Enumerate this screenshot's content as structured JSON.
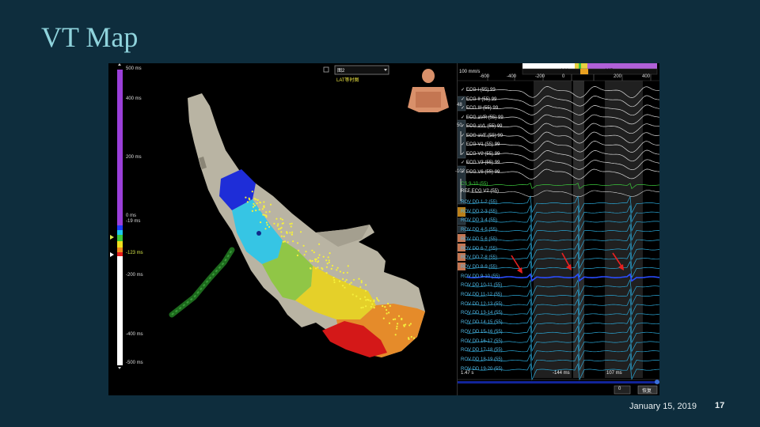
{
  "slide": {
    "title": "VT Map",
    "date": "January 15, 2019",
    "page_number": "17"
  },
  "map": {
    "view_select_value": "图2",
    "lat_label": "LAT等时图",
    "scale_ticks": [
      "500 ms",
      "400 ms",
      "200 ms",
      "0 ms",
      "-19 ms",
      "-123 ms",
      "-200 ms",
      "-400 ms",
      "-500 ms"
    ],
    "palette": {
      "purple": "#9b3fd9",
      "blue": "#1e3cff",
      "cyan": "#1ec8f0",
      "green": "#3cc83c",
      "yellow": "#f0e01e",
      "orange": "#f08c1e",
      "red": "#e61e1e",
      "white": "#ffffff"
    }
  },
  "ep": {
    "sweep_speed": "100 mm/s",
    "timeline_labels": [
      "-600",
      "-400",
      "-200",
      "0",
      "200",
      "400"
    ],
    "timeline_markers": [
      "-144 ms",
      "107 ms"
    ],
    "ecg_channels": [
      {
        "name": "ECG I (55)",
        "value": "99"
      },
      {
        "name": "ECG II (55)",
        "value": "99"
      },
      {
        "name": "ECG III (55)",
        "value": "99"
      },
      {
        "name": "ECG aVR (55)",
        "value": "99"
      },
      {
        "name": "ECG aVL (55)",
        "value": "99"
      },
      {
        "name": "ECG aVF (55)",
        "value": "99"
      },
      {
        "name": "ECG V1 (55)",
        "value": "99"
      },
      {
        "name": "ECG V2 (55)",
        "value": "99"
      },
      {
        "name": "ECG V3 (55)",
        "value": "99"
      },
      {
        "name": "ECG V6 (55)",
        "value": "99"
      }
    ],
    "cs_channel": "CS 9-10 (55)",
    "ref_channel": "REF ECG V2 (55)",
    "rov_channels": [
      "ROV DD 1-2 (55)",
      "ROV DD 2-3 (55)",
      "ROV DD 3-4 (55)",
      "ROV DD 4-5 (55)",
      "ROV DD 5-6 (55)",
      "ROV DD 6-7 (55)",
      "ROV DD 7-8 (55)",
      "ROV DD 8-9 (55)",
      "ROV DD 9-10 (55)",
      "ROV DD 10-11 (55)",
      "ROV DD 11-12 (55)",
      "ROV DD 12-13 (55)",
      "ROV DD 13-14 (55)",
      "ROV DD 14-15 (55)",
      "ROV DD 15-16 (55)",
      "ROV DD 16-17 (55)",
      "ROV DD 17-18 (55)",
      "ROV DD 18-19 (55)",
      "ROV DD 19-20 (55)"
    ],
    "time_readout": "1.47 s",
    "bottom_markers": [
      "-144 ms",
      "107 ms"
    ],
    "dropdown_value": "0",
    "restore_label": "恢复",
    "toolbar_values": [
      "48",
      "50",
      "-102"
    ]
  }
}
